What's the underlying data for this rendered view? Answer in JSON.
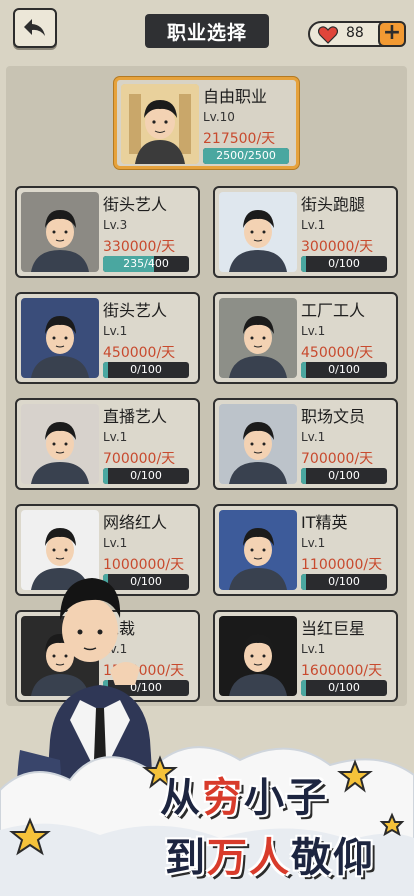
{
  "header": {
    "title": "职业选择",
    "hearts_count": "88"
  },
  "featured": {
    "name": "自由职业",
    "level": "Lv.10",
    "salary": "217500/天",
    "progress_text": "2500/2500",
    "progress": 1.0
  },
  "jobs": [
    {
      "name": "街头艺人",
      "level": "Lv.3",
      "salary": "330000/天",
      "progress_text": "235/400",
      "progress": 0.59
    },
    {
      "name": "街头跑腿",
      "level": "Lv.1",
      "salary": "300000/天",
      "progress_text": "0/100",
      "progress": 0.0
    },
    {
      "name": "街头艺人",
      "level": "Lv.1",
      "salary": "450000/天",
      "progress_text": "0/100",
      "progress": 0.0
    },
    {
      "name": "工厂工人",
      "level": "Lv.1",
      "salary": "450000/天",
      "progress_text": "0/100",
      "progress": 0.0
    },
    {
      "name": "直播艺人",
      "level": "Lv.1",
      "salary": "700000/天",
      "progress_text": "0/100",
      "progress": 0.0
    },
    {
      "name": "职场文员",
      "level": "Lv.1",
      "salary": "700000/天",
      "progress_text": "0/100",
      "progress": 0.0
    },
    {
      "name": "网络红人",
      "level": "Lv.1",
      "salary": "1000000/天",
      "progress_text": "0/100",
      "progress": 0.0
    },
    {
      "name": "IT精英",
      "level": "Lv.1",
      "salary": "1100000/天",
      "progress_text": "0/100",
      "progress": 0.0
    },
    {
      "name": "总裁",
      "level": "Lv.1",
      "salary": "1500000/天",
      "progress_text": "0/100",
      "progress": 0.0
    },
    {
      "name": "当红巨星",
      "level": "Lv.1",
      "salary": "1600000/天",
      "progress_text": "0/100",
      "progress": 0.0
    }
  ],
  "slogan": {
    "line1_a": "从",
    "line1_b": "穷",
    "line1_c": "小子",
    "line2_a": "到",
    "line2_b": "万人",
    "line2_c": "敬仰"
  },
  "colors": {
    "accent_orange": "#f29a33",
    "salary_red": "#c84a2e",
    "progress_teal": "#4aa7a0",
    "featured_border": "#e6a23c"
  }
}
